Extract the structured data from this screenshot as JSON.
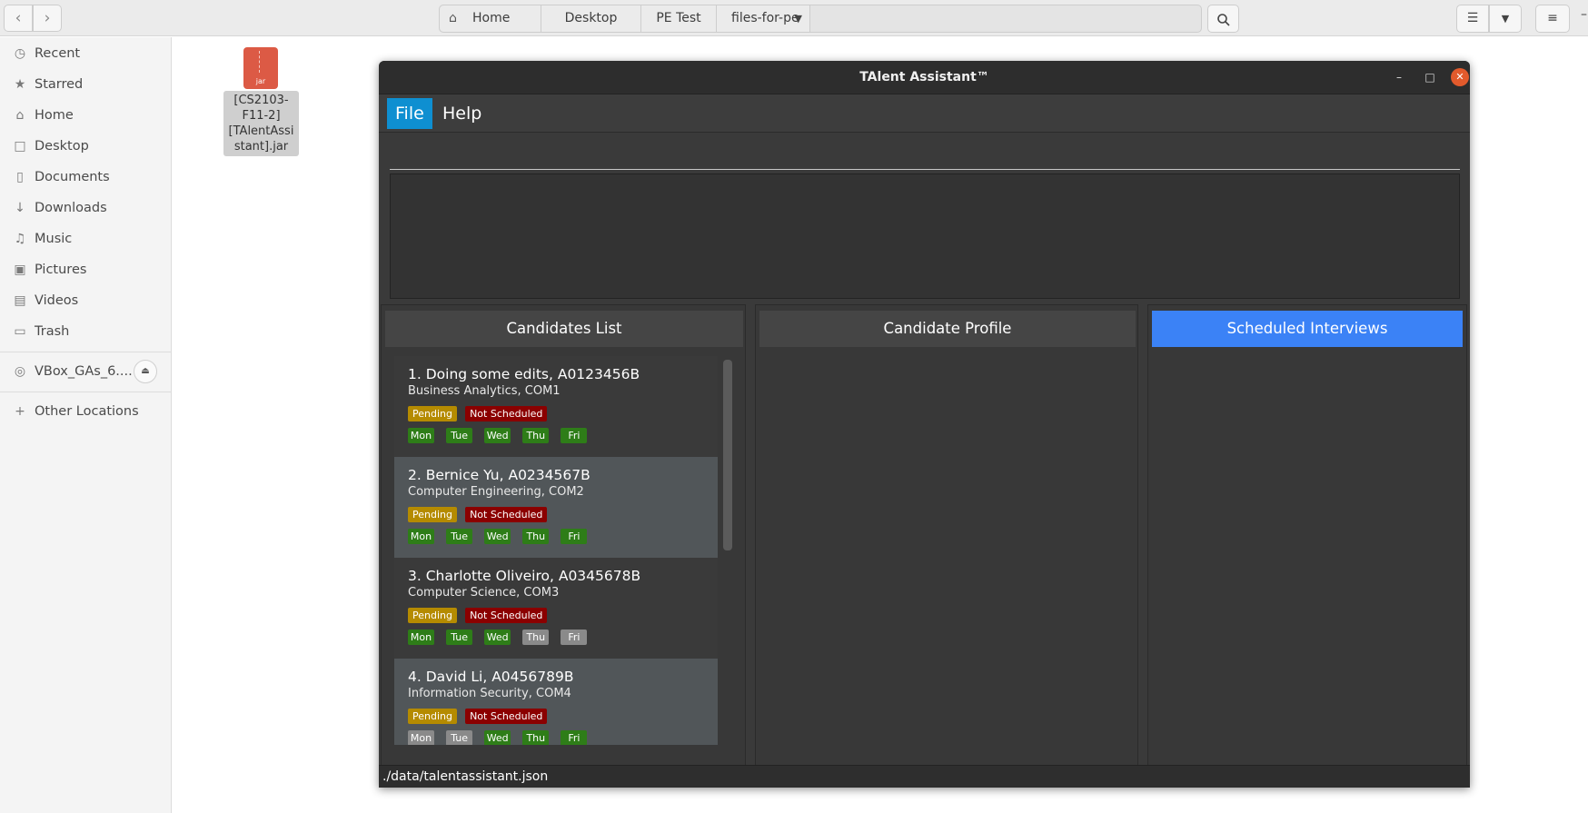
{
  "headerbar": {
    "back_icon": "chevron-left-icon",
    "forward_icon": "chevron-right-icon",
    "breadcrumbs": [
      "Home",
      "Desktop",
      "PE Test",
      "files-for-pe"
    ],
    "search_icon": "search-icon",
    "view_icon": "list-view-icon",
    "menu_icon": "hamburger-icon"
  },
  "sidebar": {
    "items": [
      {
        "label": "Recent",
        "icon": "clock-icon"
      },
      {
        "label": "Starred",
        "icon": "star-icon"
      },
      {
        "label": "Home",
        "icon": "home-icon"
      },
      {
        "label": "Desktop",
        "icon": "desktop-icon"
      },
      {
        "label": "Documents",
        "icon": "document-icon"
      },
      {
        "label": "Downloads",
        "icon": "download-icon"
      },
      {
        "label": "Music",
        "icon": "music-icon"
      },
      {
        "label": "Pictures",
        "icon": "pictures-icon"
      },
      {
        "label": "Videos",
        "icon": "videos-icon"
      },
      {
        "label": "Trash",
        "icon": "trash-icon"
      }
    ],
    "device": {
      "label": "VBox_GAs_6....",
      "icon": "disc-icon"
    },
    "other": {
      "label": "Other Locations",
      "icon": "plus-icon"
    }
  },
  "desktop_file": {
    "name": "[CS2103-\nF11-2]\n[TAlentAssi\nstant].jar",
    "ext": "jar"
  },
  "app": {
    "title": "TAlent Assistant™",
    "menu": [
      "File",
      "Help"
    ],
    "panels": [
      "Candidates List",
      "Candidate Profile",
      "Scheduled Interviews"
    ],
    "candidates": [
      {
        "name": "1.  Doing some edits, A0123456B",
        "course": "Business Analytics, COM1",
        "status": "Pending",
        "schedule": "Not Scheduled",
        "days": [
          {
            "d": "Mon",
            "on": true
          },
          {
            "d": "Tue",
            "on": true
          },
          {
            "d": "Wed",
            "on": true
          },
          {
            "d": "Thu",
            "on": true
          },
          {
            "d": "Fri",
            "on": true
          }
        ]
      },
      {
        "name": "2.  Bernice Yu, A0234567B",
        "course": "Computer Engineering, COM2",
        "status": "Pending",
        "schedule": "Not Scheduled",
        "days": [
          {
            "d": "Mon",
            "on": true
          },
          {
            "d": "Tue",
            "on": true
          },
          {
            "d": "Wed",
            "on": true
          },
          {
            "d": "Thu",
            "on": true
          },
          {
            "d": "Fri",
            "on": true
          }
        ]
      },
      {
        "name": "3.  Charlotte Oliveiro, A0345678B",
        "course": "Computer Science, COM3",
        "status": "Pending",
        "schedule": "Not Scheduled",
        "days": [
          {
            "d": "Mon",
            "on": true
          },
          {
            "d": "Tue",
            "on": true
          },
          {
            "d": "Wed",
            "on": true
          },
          {
            "d": "Thu",
            "on": false
          },
          {
            "d": "Fri",
            "on": false
          }
        ]
      },
      {
        "name": "4.  David Li, A0456789B",
        "course": "Information Security, COM4",
        "status": "Pending",
        "schedule": "Not Scheduled",
        "days": [
          {
            "d": "Mon",
            "on": false
          },
          {
            "d": "Tue",
            "on": false
          },
          {
            "d": "Wed",
            "on": true
          },
          {
            "d": "Thu",
            "on": true
          },
          {
            "d": "Fri",
            "on": true
          }
        ]
      }
    ],
    "status_path": "./data/talentassistant.json"
  }
}
